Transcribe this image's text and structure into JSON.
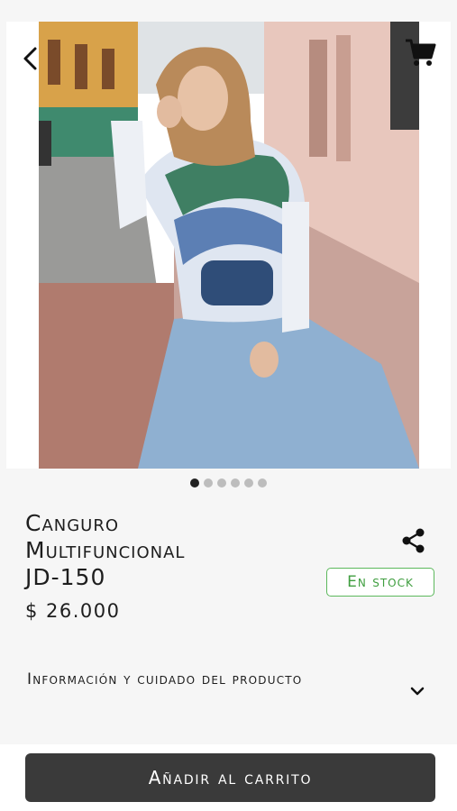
{
  "product": {
    "title_line1": "Canguro",
    "title_line2": "Multifuncional",
    "title_line3": "JD-150",
    "price": "$ 26.000",
    "stock_label": "En stock",
    "image_dots_total": 6,
    "image_dots_active": 1
  },
  "info": {
    "label": "Información y cuidado del producto"
  },
  "actions": {
    "add_to_cart": "Añadir al carrito"
  },
  "icons": {
    "back": "back-arrow-icon",
    "cart": "shopping-cart-icon",
    "share": "share-icon",
    "expand": "chevron-down-icon"
  },
  "colors": {
    "stock_green": "#5cb85c",
    "button_dark": "#3a3a3a",
    "background": "#f6f6f6"
  }
}
